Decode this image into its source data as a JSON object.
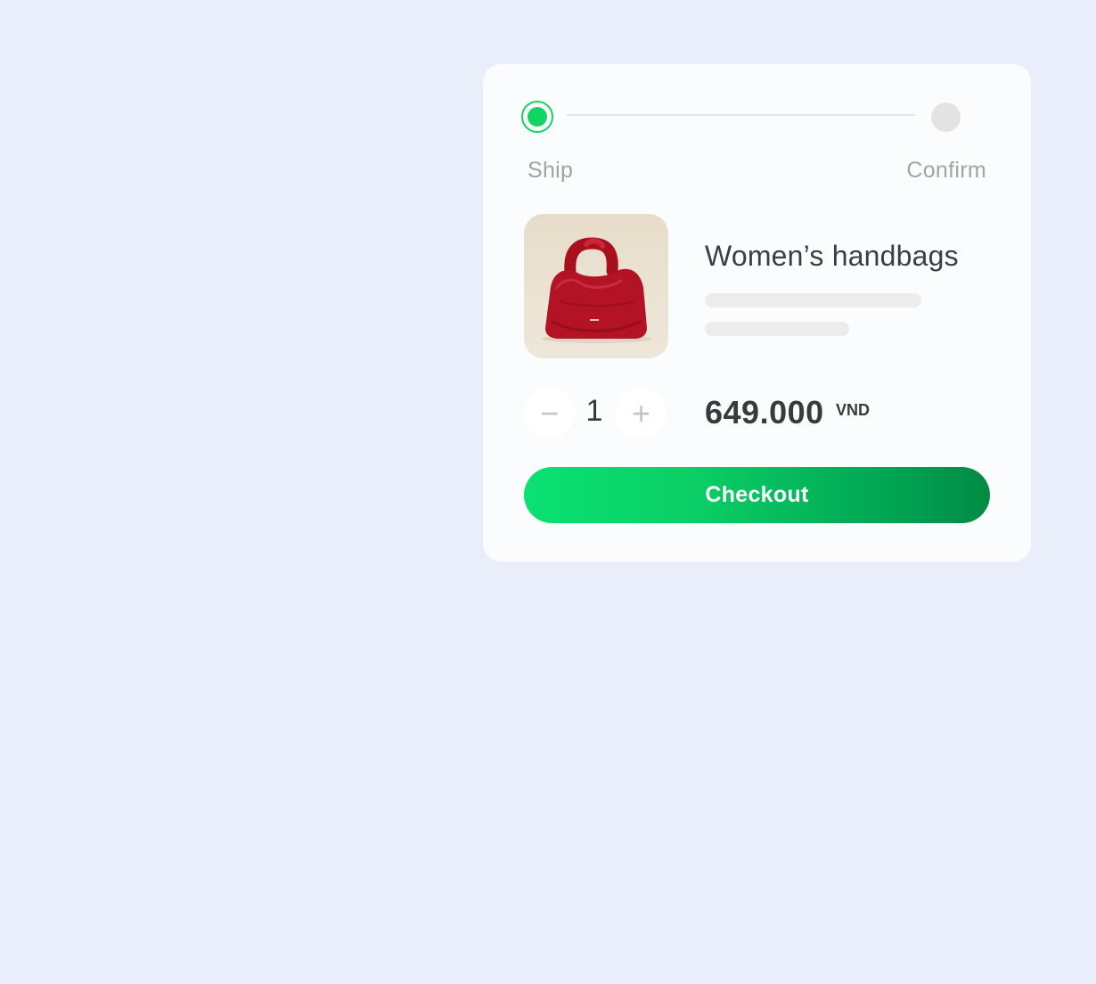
{
  "steps": {
    "ship_label": "Ship",
    "confirm_label": "Confirm",
    "active_step": "Ship"
  },
  "product": {
    "image_icon": "red-handbag-image",
    "title": "Women’s handbags",
    "quantity": "1",
    "minus_symbol": "−",
    "plus_symbol": "+",
    "price": "649.000",
    "currency": "VND"
  },
  "checkout": {
    "label": "Checkout"
  },
  "colors": {
    "accent": "#11d461",
    "button_start": "#0ae173",
    "button_end": "#038a45",
    "background": "#eaeefa"
  }
}
